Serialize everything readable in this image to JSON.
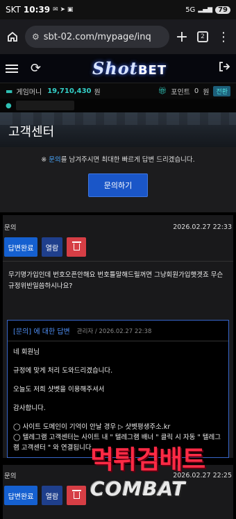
{
  "status": {
    "carrier": "SKT",
    "time": "10:39",
    "network": "5G",
    "battery": "79"
  },
  "browser": {
    "url": "sbt-02.com/mypage/inq",
    "tab_count": "2"
  },
  "site": {
    "logo": "Shot",
    "logo_suffix": "BET",
    "money_label": "게임머니",
    "money_value": "19,710,430",
    "money_unit": "원",
    "point_label": "포인트",
    "point_value": "0",
    "point_unit": "원",
    "convert_label": "전환"
  },
  "banner": {
    "title": "고객센터"
  },
  "notice": {
    "prefix": "※ ",
    "highlight": "문의",
    "suffix": "를 남겨주시면 최대한 빠르게 답변 드리겠습니다.",
    "button": "문의하기"
  },
  "inquiries": [
    {
      "label": "문의",
      "date": "2026.02.27 22:33",
      "status_btn": "답변완료",
      "view_btn": "열람",
      "question": "무기명가입인데 번호오픈안해요 번호틀말해드릴꺼면 그냥회원가입햇겟죠 무슨규정위반일씀하시나요?",
      "answer": {
        "title": "[문의] 에 대한 답변",
        "author": "관리자",
        "date": "2026.02.27 22:38",
        "lines": [
          "네 회원님",
          "규정에 맞게 처리 도와드리겠습니다.",
          "오늘도 저희 샷벳을 이용해주셔서",
          "감사합니다.",
          "◯ 사이트 도메인이 기억이 안날 경우 ▷ 샷벳평생주소.kr",
          "◯ 텔레그램 고객센터는 사이트 내 \" 텔레그램 배너 \" 클릭 시 자동 \" 텔레그램 고객센터 \" 와 연결됩니다."
        ]
      }
    },
    {
      "label": "문의",
      "date": "2026.02.27 22:25",
      "status_btn": "답변완료",
      "view_btn": "열람"
    }
  ],
  "watermark": {
    "top": "먹튀검배트",
    "bottom": "COMBAT"
  }
}
